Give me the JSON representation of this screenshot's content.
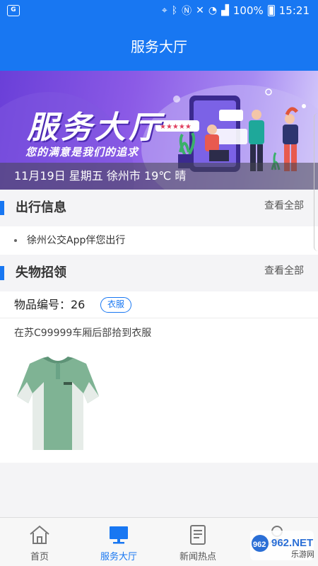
{
  "status_bar": {
    "battery": "100%",
    "time": "15:21"
  },
  "header": {
    "title": "服务大厅"
  },
  "banner": {
    "title": "服务大厅",
    "subtitle": "您的满意是我们的追求",
    "weather": "11月19日 星期五 徐州市 19℃ 晴"
  },
  "travel": {
    "title": "出行信息",
    "more_label": "查看全部",
    "items": [
      {
        "text": "徐州公交App伴您出行"
      }
    ]
  },
  "lost_found": {
    "title": "失物招领",
    "more_label": "查看全部",
    "items": [
      {
        "item_no": "物品编号：26",
        "category": "衣服",
        "description": "在苏C99999车厢后部拾到衣服",
        "image_icon": "polo-shirt-image"
      }
    ]
  },
  "tabs": [
    {
      "label": "首页",
      "icon": "home-icon",
      "active": false
    },
    {
      "label": "服务大厅",
      "icon": "monitor-icon",
      "active": true
    },
    {
      "label": "新闻热点",
      "icon": "news-icon",
      "active": false
    },
    {
      "label": "",
      "icon": "user-icon",
      "active": false
    }
  ],
  "watermark": {
    "text": "962.NET",
    "subtext": "乐游网"
  },
  "colors": {
    "primary": "#1877f2",
    "banner_start": "#6a3fd8",
    "banner_end": "#d9d0fb"
  }
}
